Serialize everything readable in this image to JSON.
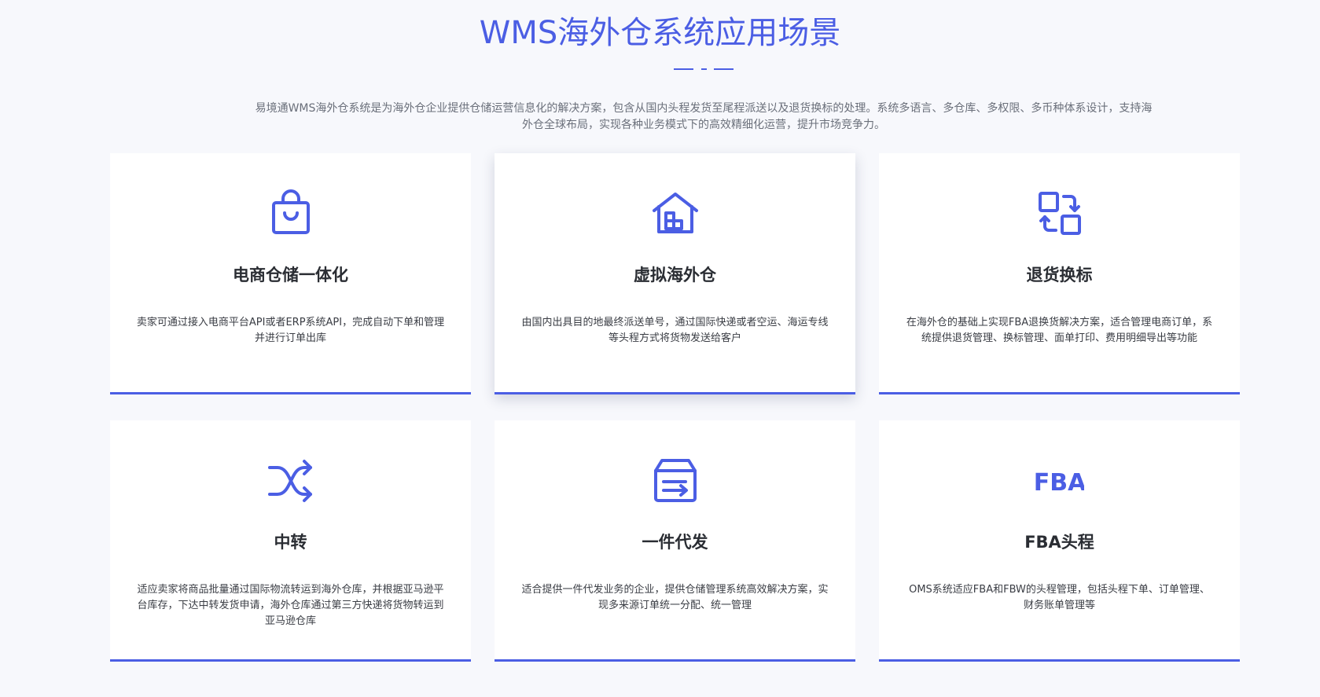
{
  "header": {
    "title": "WMS海外仓系统应用场景",
    "intro": "易境通WMS海外仓系统是为海外仓企业提供仓储运营信息化的解决方案，包含从国内头程发货至尾程派送以及退货换标的处理。系统多语言、多仓库、多权限、多币种体系设计，支持海外仓全球布局，实现各种业务模式下的高效精细化运营，提升市场竞争力。"
  },
  "theme": {
    "accent": "#4b5ee4",
    "background": "#f7f8fc",
    "card": "#ffffff"
  },
  "cards": [
    {
      "icon": "shopping-bag-icon",
      "title": "电商仓储一体化",
      "desc": "卖家可通过接入电商平台API或者ERP系统API，完成自动下单和管理并进行订单出库"
    },
    {
      "icon": "warehouse-home-icon",
      "title": "虚拟海外仓",
      "desc": "由国内出具目的地最终派送单号，通过国际快递或者空运、海运专线等头程方式将货物发送给客户"
    },
    {
      "icon": "exchange-swap-icon",
      "title": "退货换标",
      "desc": "在海外仓的基础上实现FBA退换货解决方案，适合管理电商订单，系统提供退货管理、换标管理、面单打印、费用明细导出等功能"
    },
    {
      "icon": "shuffle-transfer-icon",
      "title": "中转",
      "desc": "适应卖家将商品批量通过国际物流转运到海外仓库，并根据亚马逊平台库存，下达中转发货申请，海外仓库通过第三方快递将货物转运到亚马逊仓库"
    },
    {
      "icon": "inbox-dispatch-icon",
      "title": "一件代发",
      "desc": "适合提供一件代发业务的企业，提供仓储管理系统高效解决方案，实现多来源订单统一分配、统一管理"
    },
    {
      "icon": "fba-logo-icon",
      "icon_text": "FBA",
      "title": "FBA头程",
      "desc": "OMS系统适应FBA和FBW的头程管理，包括头程下单、订单管理、财务账单管理等"
    }
  ]
}
